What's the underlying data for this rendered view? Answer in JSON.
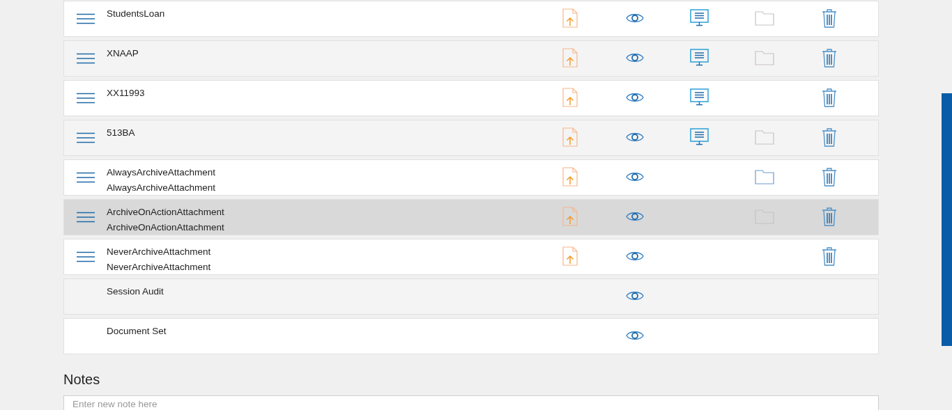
{
  "documents": [
    {
      "lines": [
        "StudentsLoan"
      ],
      "menu": true,
      "upload": true,
      "view": true,
      "display": true,
      "folder": {
        "disabled": true
      },
      "delete": true,
      "selected": false
    },
    {
      "lines": [
        "XNAAP"
      ],
      "menu": true,
      "upload": true,
      "view": true,
      "display": true,
      "folder": {
        "disabled": true
      },
      "delete": true,
      "selected": false
    },
    {
      "lines": [
        "XX11993"
      ],
      "menu": true,
      "upload": true,
      "view": true,
      "display": true,
      "delete": true,
      "selected": false
    },
    {
      "lines": [
        "513BA"
      ],
      "menu": true,
      "upload": true,
      "view": true,
      "display": true,
      "folder": {
        "disabled": true
      },
      "delete": true,
      "selected": false
    },
    {
      "lines": [
        "AlwaysArchiveAttachment",
        "AlwaysArchiveAttachment"
      ],
      "menu": true,
      "upload": true,
      "view": true,
      "display": false,
      "folder": {
        "disabled": false
      },
      "delete": true,
      "selected": false
    },
    {
      "lines": [
        "ArchiveOnActionAttachment",
        "ArchiveOnActionAttachment"
      ],
      "menu": true,
      "upload": true,
      "view": true,
      "display": false,
      "folder": {
        "disabled": true
      },
      "delete": true,
      "selected": true
    },
    {
      "lines": [
        "NeverArchiveAttachment",
        "NeverArchiveAttachment"
      ],
      "menu": true,
      "upload": true,
      "view": true,
      "display": false,
      "delete": true,
      "selected": false
    },
    {
      "lines": [
        "Session Audit"
      ],
      "menu": false,
      "upload": false,
      "view": true,
      "display": false,
      "delete": false,
      "selected": false
    },
    {
      "lines": [
        "Document Set"
      ],
      "menu": false,
      "upload": false,
      "view": true,
      "display": false,
      "delete": false,
      "selected": false
    }
  ],
  "notes": {
    "title": "Notes",
    "placeholder": "Enter new note here"
  }
}
